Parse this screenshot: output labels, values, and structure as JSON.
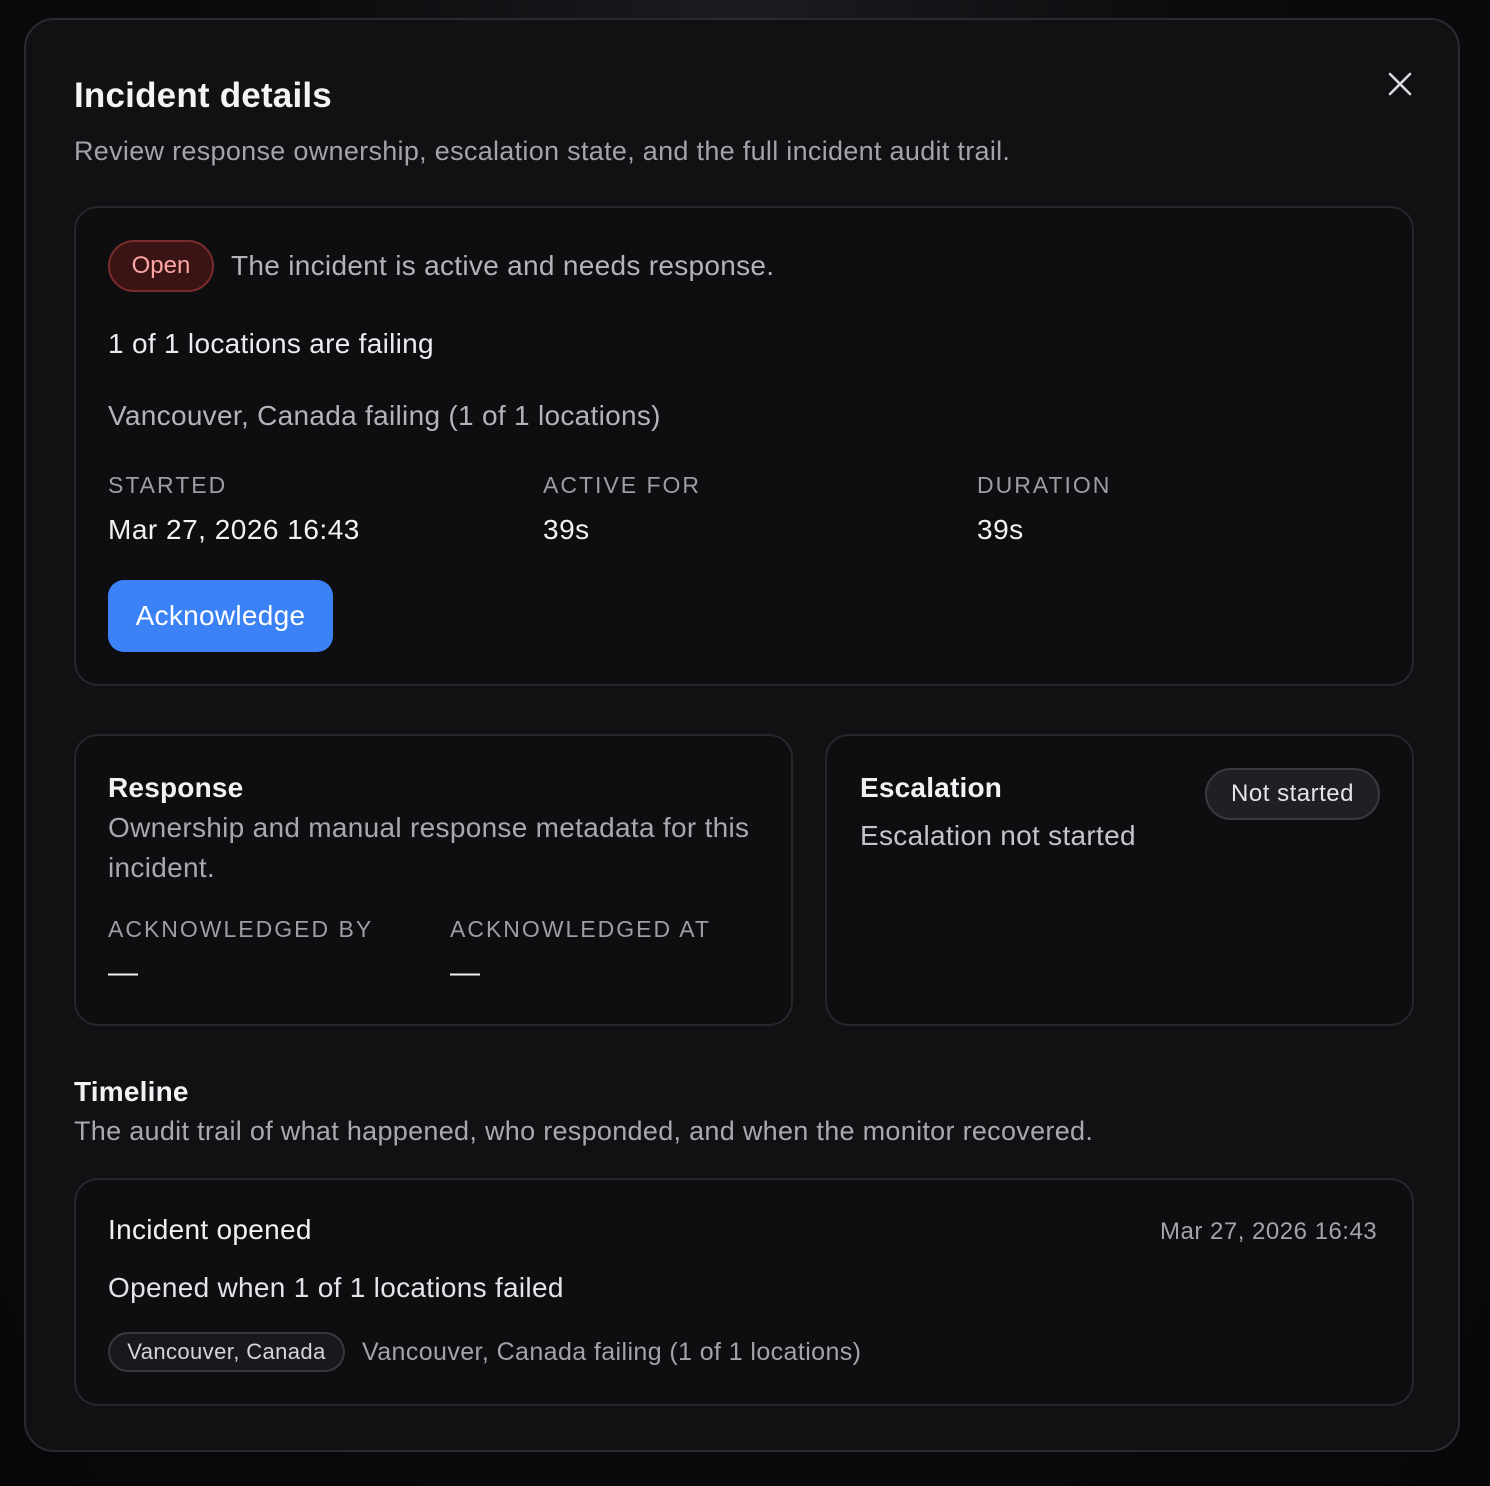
{
  "dialog": {
    "title": "Incident details",
    "subtitle": "Review response ownership, escalation state, and the full incident audit trail.",
    "close_icon": "close-icon"
  },
  "summary": {
    "status_badge": "Open",
    "status_message": "The incident is active and needs response.",
    "failing_headline": "1 of 1 locations are failing",
    "failing_detail": "Vancouver, Canada failing (1 of 1 locations)",
    "meta": [
      {
        "label": "STARTED",
        "value": "Mar 27, 2026 16:43"
      },
      {
        "label": "ACTIVE FOR",
        "value": "39s"
      },
      {
        "label": "DURATION",
        "value": "39s"
      }
    ],
    "acknowledge_label": "Acknowledge"
  },
  "response": {
    "title": "Response",
    "description": "Ownership and manual response metadata for this incident.",
    "fields": [
      {
        "label": "ACKNOWLEDGED BY",
        "value": "—"
      },
      {
        "label": "ACKNOWLEDGED AT",
        "value": "—"
      }
    ]
  },
  "escalation": {
    "title": "Escalation",
    "status_badge": "Not started",
    "description": "Escalation not started"
  },
  "timeline": {
    "title": "Timeline",
    "description": "The audit trail of what happened, who responded, and when the monitor recovered.",
    "events": [
      {
        "title": "Incident opened",
        "time": "Mar 27, 2026 16:43",
        "description": "Opened when 1 of 1 locations failed",
        "location_tag": "Vancouver, Canada",
        "location_detail": "Vancouver, Canada failing (1 of 1 locations)"
      }
    ]
  },
  "colors": {
    "accent": "#3b82f6",
    "open_badge_bg": "#3a1414",
    "open_badge_text": "#fca5a5",
    "surface": "#111114"
  }
}
